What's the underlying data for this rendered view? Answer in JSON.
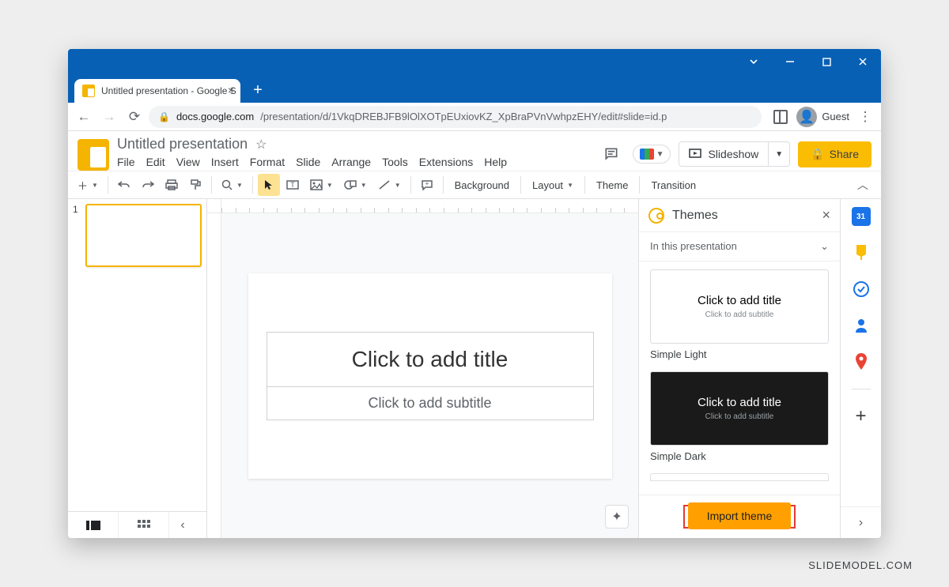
{
  "browser": {
    "tab_title": "Untitled presentation - Google S",
    "url_domain": "docs.google.com",
    "url_path": "/presentation/d/1VkqDREBJFB9lOlXOTpEUxiovKZ_XpBraPVnVwhpzEHY/edit#slide=id.p",
    "guest_label": "Guest"
  },
  "header": {
    "doc_title": "Untitled presentation",
    "menus": [
      "File",
      "Edit",
      "View",
      "Insert",
      "Format",
      "Slide",
      "Arrange",
      "Tools",
      "Extensions",
      "Help"
    ],
    "slideshow_label": "Slideshow",
    "share_label": "Share"
  },
  "toolbar": {
    "background": "Background",
    "layout": "Layout",
    "theme": "Theme",
    "transition": "Transition"
  },
  "slides": {
    "thumb_number": "1",
    "title_placeholder": "Click to add title",
    "subtitle_placeholder": "Click to add subtitle"
  },
  "themes_panel": {
    "title": "Themes",
    "section_label": "In this presentation",
    "items": [
      {
        "name": "Simple Light",
        "title": "Click to add title",
        "sub": "Click to add subtitle",
        "dark": false
      },
      {
        "name": "Simple Dark",
        "title": "Click to add title",
        "sub": "Click to add subtitle",
        "dark": true
      }
    ],
    "import_label": "Import theme"
  },
  "watermark": "SLIDEMODEL.COM"
}
